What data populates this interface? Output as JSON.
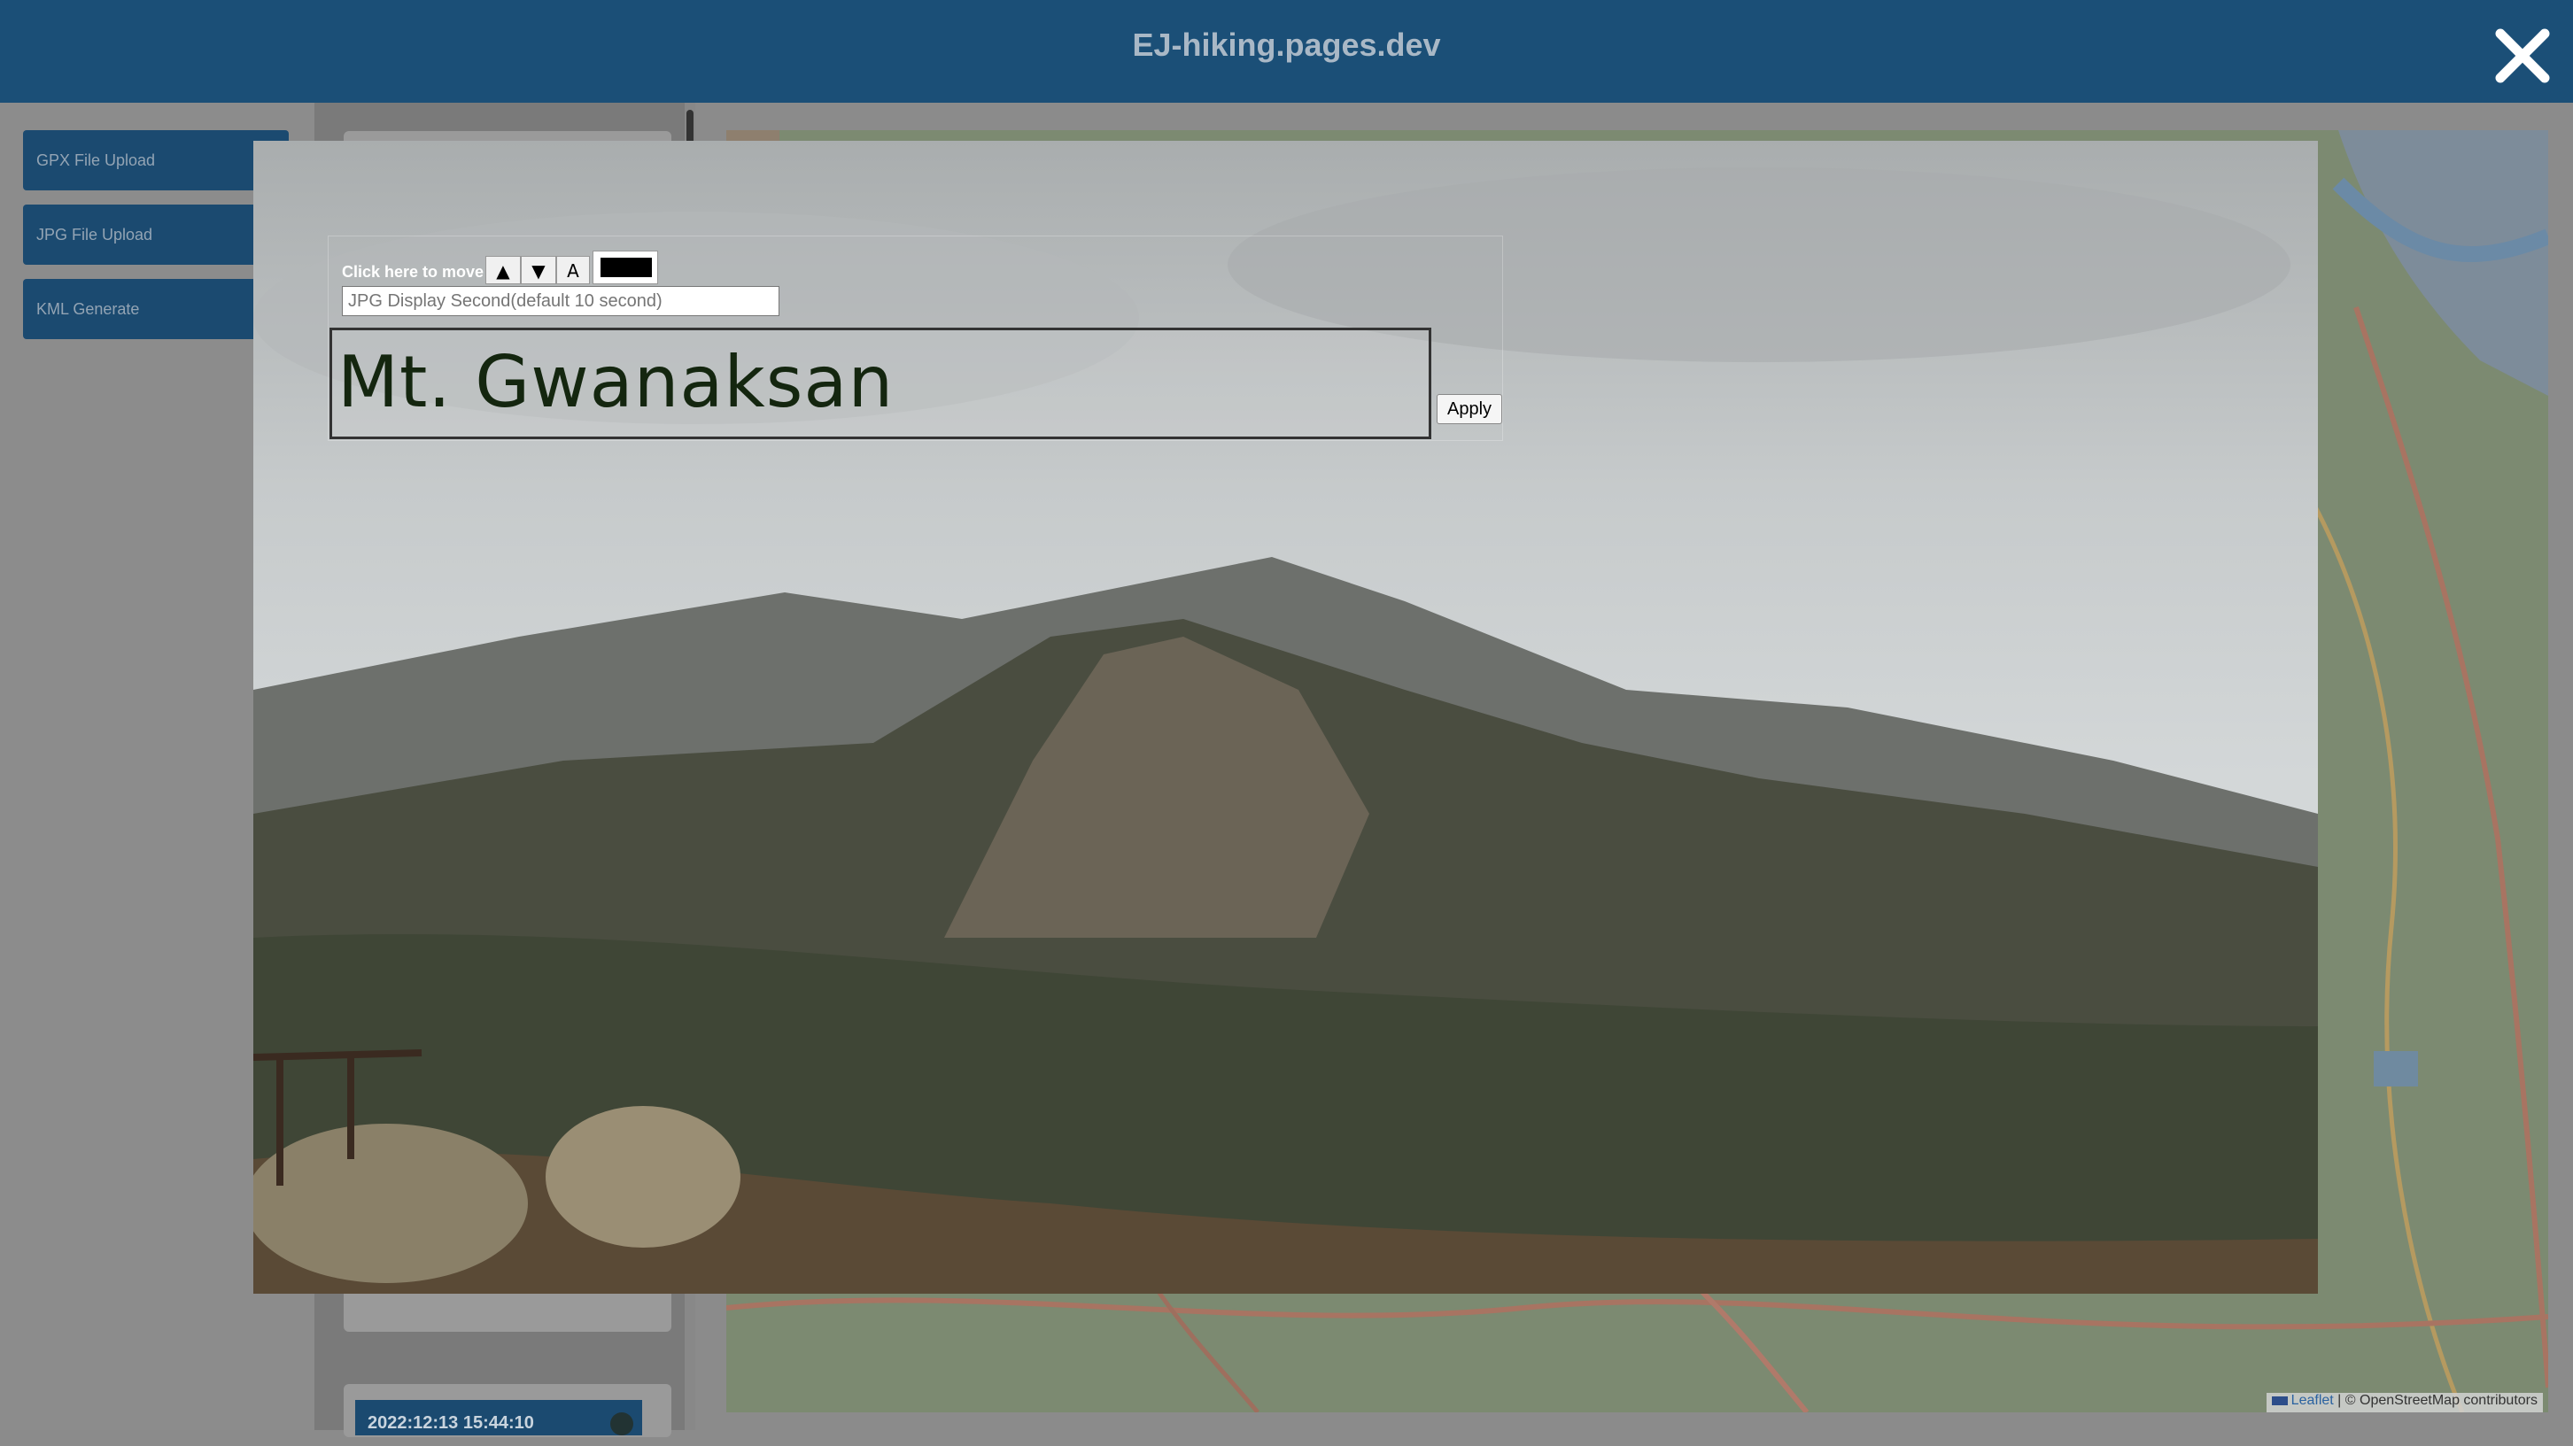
{
  "header": {
    "title": "EJ-hiking.pages.dev",
    "close_icon": "close-icon"
  },
  "sidebar": {
    "buttons": [
      {
        "label": "GPX File Upload",
        "icon": "gear-icon"
      },
      {
        "label": "JPG File Upload",
        "icon": "gear-icon"
      },
      {
        "label": "KML Generate",
        "icon": "gear-icon"
      }
    ]
  },
  "list": {
    "date_label": "2022:12:13 15:44:10"
  },
  "map": {
    "attribution_leaflet": "Leaflet",
    "attribution_rest": "| © OpenStreetMap contributors"
  },
  "editor": {
    "move_label": "Click here to move",
    "up_label": "▲",
    "down_label": "▼",
    "font_label": "A",
    "text_color": "#000000",
    "seconds_placeholder": "JPG Display Second(default 10 second)",
    "seconds_value": "",
    "caption": "Mt. Gwanaksan",
    "apply_label": "Apply"
  },
  "colors": {
    "header_bg": "#1b4f77",
    "button_bg": "#1b4a70",
    "caption_text": "#14260f"
  }
}
